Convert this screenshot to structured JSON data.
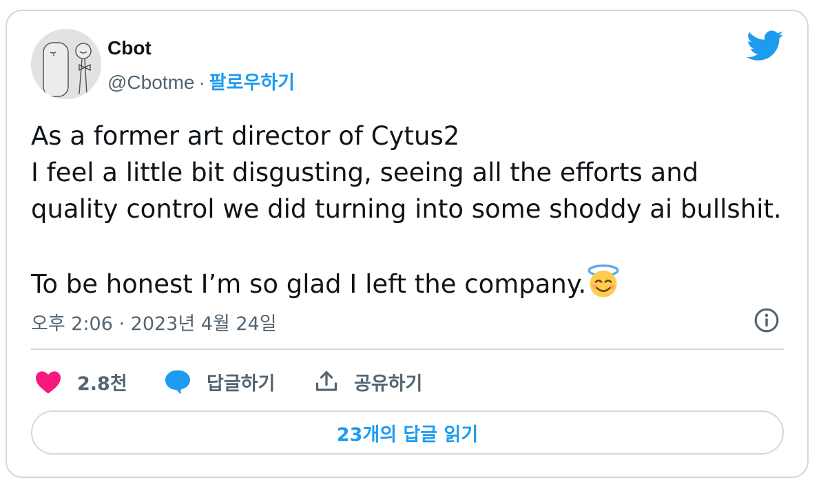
{
  "author": {
    "name": "Cbot",
    "handle": "@Cbotme",
    "separator": "·",
    "follow_label": "팔로우하기"
  },
  "tweet": {
    "text": "As a former art director of Cytus2\nI feel a little bit disgusting, seeing all the efforts and\nquality control we did turning into some shoddy ai bullshit.\n\nTo be honest I’m so glad I left the company.",
    "emoji": "smiling-face-with-halo",
    "timestamp": "오후 2:06 · 2023년 4월 24일"
  },
  "actions": {
    "like_count": "2.8천",
    "reply_label": "답글하기",
    "share_label": "공유하기"
  },
  "read_replies_label": "23개의 답글 읽기",
  "colors": {
    "accent": "#1d9bf0",
    "like": "#f91880",
    "border": "#cfd9de",
    "secondary_text": "#536471"
  }
}
